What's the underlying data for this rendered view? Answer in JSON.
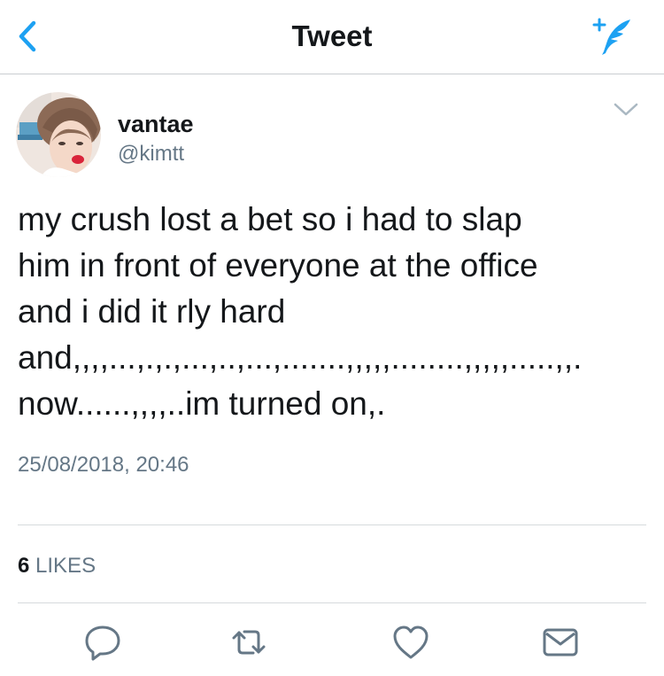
{
  "navbar": {
    "title": "Tweet"
  },
  "tweet": {
    "author": {
      "display_name": "vantae",
      "handle": "@kimtt"
    },
    "text_lines": [
      "my crush lost a bet so i had to slap",
      "him in front of everyone at the office",
      "and i did it rly hard",
      "and,,,,...,.,.,...,..,...,.......,,,,,........,,,,,.....,,.",
      "now......,,,,..im turned on,."
    ],
    "timestamp": "25/08/2018, 20:46",
    "likes": {
      "count": "6",
      "label": "LIKES"
    }
  },
  "colors": {
    "accent": "#1da1f2",
    "secondary_text": "#657786",
    "action_icon": "#657786",
    "divider": "#d6dadd"
  },
  "icons": {
    "back": "chevron-left-icon",
    "compose": "compose-feather-icon",
    "caret": "chevron-down-icon",
    "reply": "reply-icon",
    "retweet": "retweet-icon",
    "like": "heart-icon",
    "message": "envelope-icon"
  }
}
